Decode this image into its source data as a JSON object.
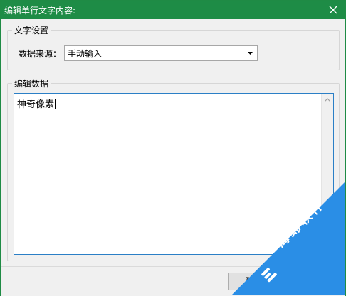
{
  "window": {
    "title": "编辑单行文字内容:",
    "close_icon": "close-icon"
  },
  "text_settings": {
    "legend": "文字设置",
    "source_label": "数据来源：",
    "source_value": "手动输入",
    "dropdown_icon": "chevron-down-icon"
  },
  "edit_data": {
    "legend": "编辑数据",
    "content": "神奇像素"
  },
  "footer": {
    "confirm_label": "确定"
  },
  "watermark": {
    "text": "海绵软件",
    "logo_icon": "sponge-logo-icon",
    "color": "#2a8ee6"
  },
  "colors": {
    "titlebar": "#1e8c46",
    "text_focus_border": "#2b7fc6"
  }
}
